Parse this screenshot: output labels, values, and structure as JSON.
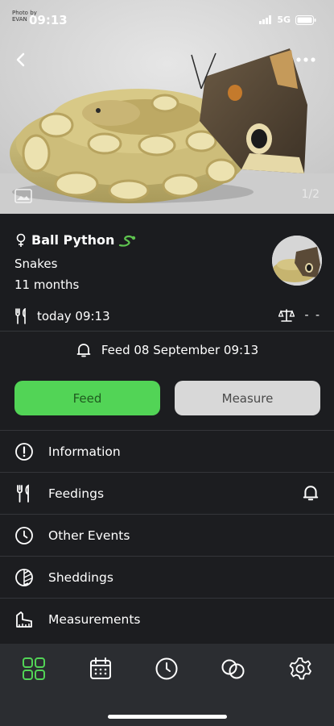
{
  "status_bar": {
    "time": "09:13",
    "network": "5G",
    "photo_credit": "Photo by\nEVAN"
  },
  "hero": {
    "photo_counter": "1/2"
  },
  "pet": {
    "name": "Ball Python",
    "species": "Snakes",
    "age": "11 months",
    "last_feeding": "today 09:13",
    "weight": "- -"
  },
  "reminder": {
    "text": "Feed 08 September 09:13"
  },
  "actions": {
    "feed_label": "Feed",
    "measure_label": "Measure"
  },
  "menu": {
    "items": [
      {
        "label": "Information",
        "icon": "info-icon"
      },
      {
        "label": "Feedings",
        "icon": "fork-knife-icon"
      },
      {
        "label": "Other Events",
        "icon": "clock-icon"
      },
      {
        "label": "Sheddings",
        "icon": "shedding-icon"
      },
      {
        "label": "Measurements",
        "icon": "ruler-icon"
      }
    ]
  },
  "tabs": [
    {
      "name": "Pets",
      "icon": "grid-icon",
      "active": true
    },
    {
      "name": "Calendar",
      "icon": "calendar-icon",
      "active": false
    },
    {
      "name": "History",
      "icon": "clock-icon",
      "active": false
    },
    {
      "name": "Breeding",
      "icon": "rings-icon",
      "active": false
    },
    {
      "name": "Settings",
      "icon": "gear-icon",
      "active": false
    }
  ],
  "colors": {
    "accent": "#52d456",
    "background": "#1b1c1f",
    "tabbar": "#2b2d31",
    "secondary_button": "#d8d8d8"
  }
}
